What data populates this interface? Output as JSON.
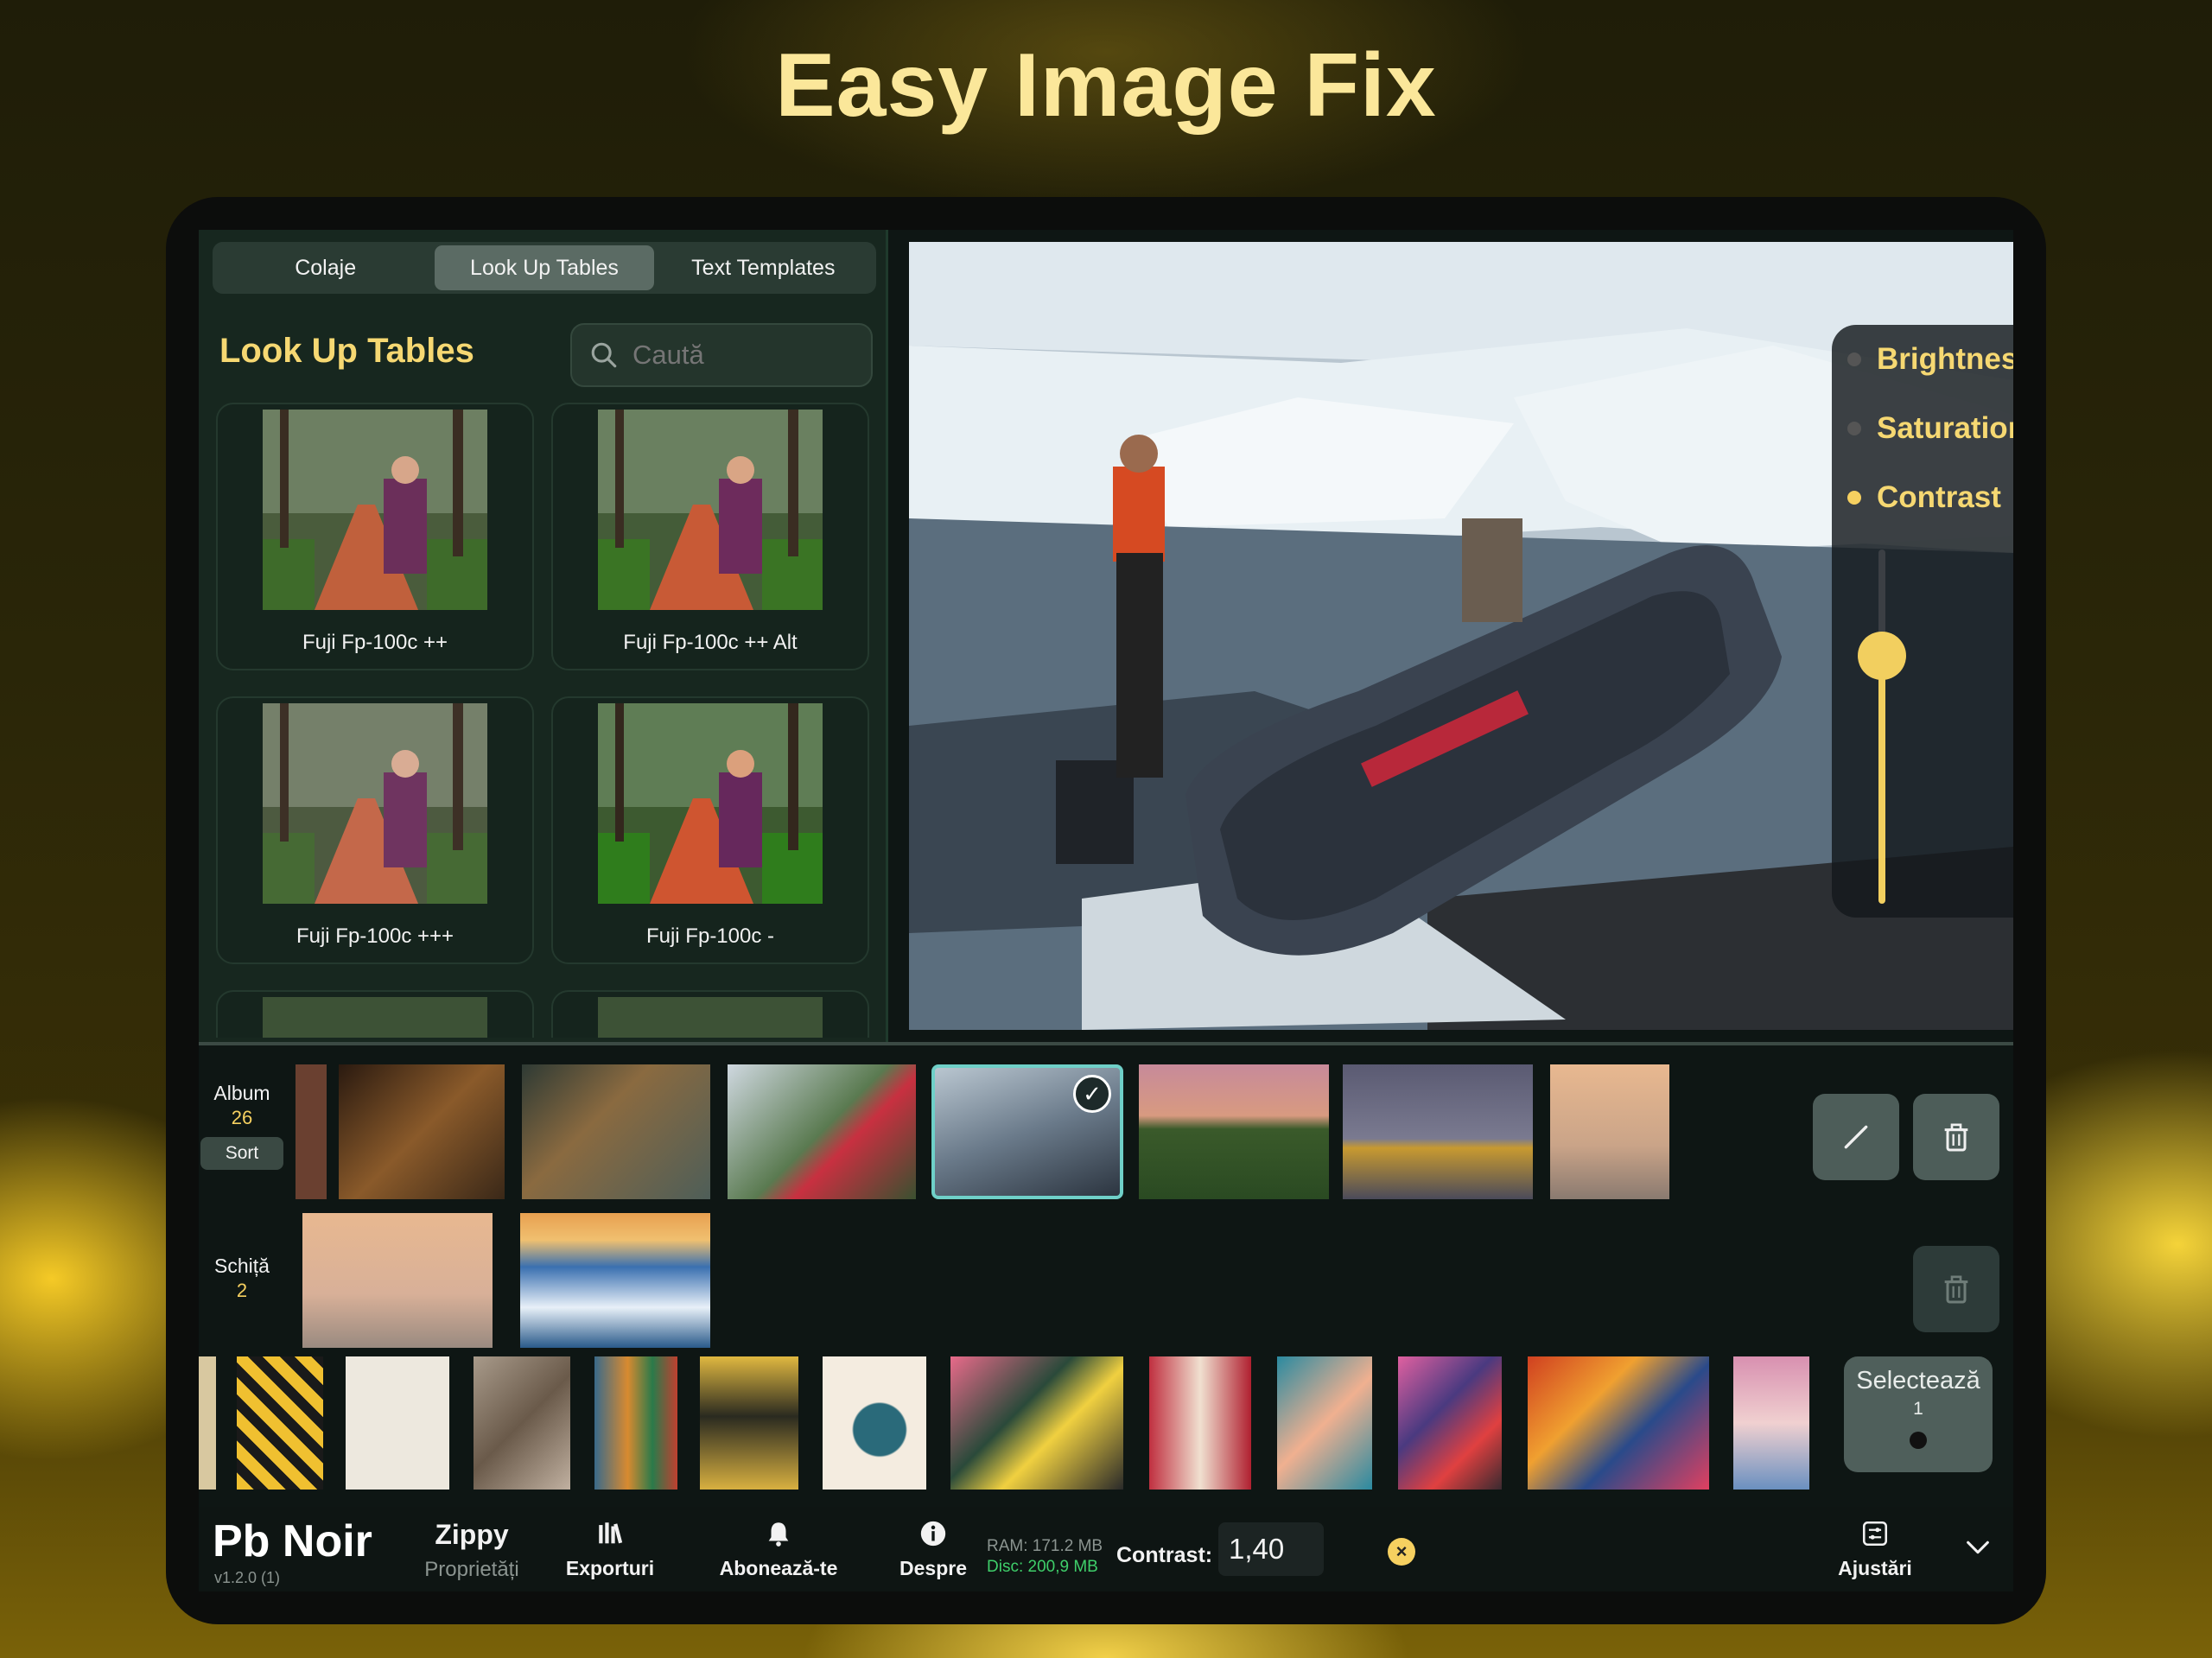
{
  "hero": {
    "title": "Easy Image Fix"
  },
  "tabs": [
    {
      "label": "Colaje",
      "active": false
    },
    {
      "label": "Look Up Tables",
      "active": true
    },
    {
      "label": "Text Templates",
      "active": false
    }
  ],
  "panel": {
    "title": "Look Up Tables",
    "search_placeholder": "Caută",
    "items": [
      {
        "label": "Fuji Fp-100c ++"
      },
      {
        "label": "Fuji Fp-100c ++ Alt"
      },
      {
        "label": "Fuji Fp-100c +++"
      },
      {
        "label": "Fuji Fp-100c -"
      }
    ]
  },
  "adjustments": {
    "items": [
      {
        "label": "Brightness",
        "active": false
      },
      {
        "label": "Saturation",
        "active": false
      },
      {
        "label": "Contrast",
        "active": true
      }
    ],
    "slider_level": 0.7
  },
  "album": {
    "label": "Album",
    "count": "26",
    "sort_label": "Sort"
  },
  "sketch": {
    "label": "Schiță",
    "count": "2"
  },
  "select_button": {
    "label": "Selectează",
    "count": "1"
  },
  "bottom": {
    "brand": "Pb Noir",
    "version": "v1.2.0 (1)",
    "items": [
      {
        "label": "Zippy",
        "sub": "Proprietăți"
      },
      {
        "label": "Exporturi"
      },
      {
        "label": "Abonează-te"
      },
      {
        "label": "Despre"
      }
    ],
    "ram": "RAM: 171.2 MB",
    "disc": "Disc: 200,9 MB",
    "param_label": "Contrast:",
    "param_value": "1,40",
    "adjust_label": "Ajustări"
  },
  "colors": {
    "accent": "#f6d060",
    "title": "#fbe79a",
    "panel": "#17271f"
  }
}
